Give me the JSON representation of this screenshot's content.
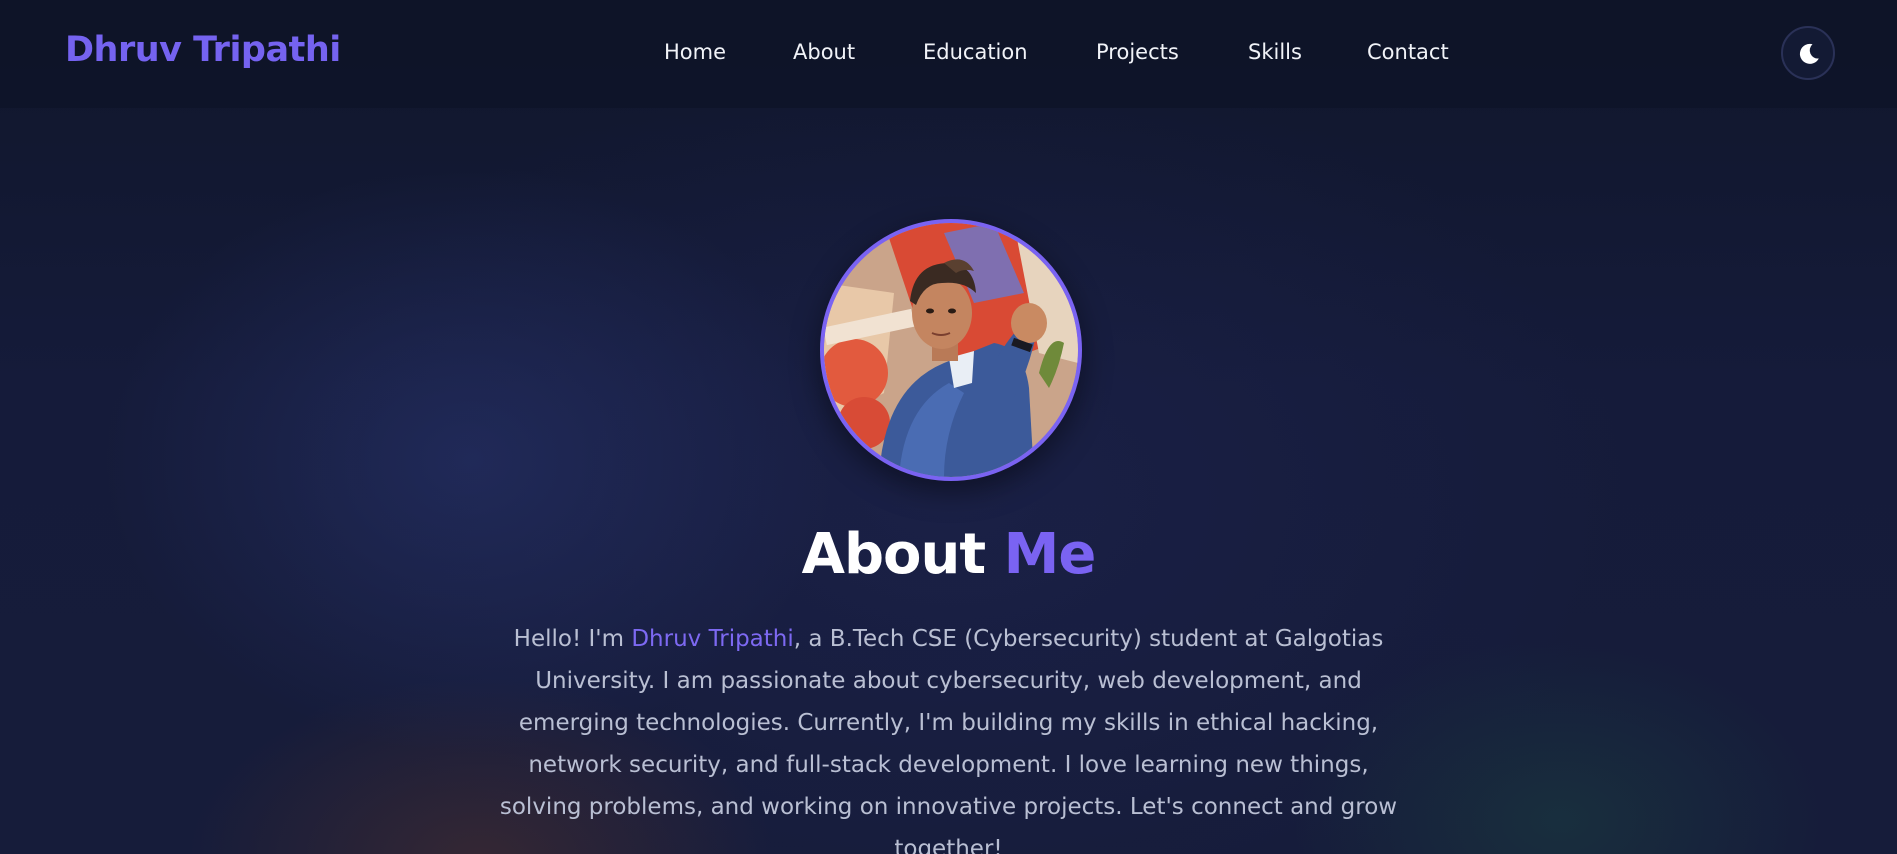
{
  "brand": "Dhruv Tripathi",
  "nav": {
    "items": [
      {
        "label": "Home"
      },
      {
        "label": "About"
      },
      {
        "label": "Education"
      },
      {
        "label": "Projects"
      },
      {
        "label": "Skills"
      },
      {
        "label": "Contact"
      }
    ]
  },
  "theme_toggle": {
    "icon": "moon-icon"
  },
  "profile": {
    "avatar": "profile-photo"
  },
  "about": {
    "title_main": "About",
    "title_accent": "Me",
    "intro_prefix": "Hello! I'm ",
    "intro_name": "Dhruv Tripathi",
    "intro_rest": ", a B.Tech CSE (Cybersecurity) student at Galgotias University. I am passionate about cybersecurity, web development, and emerging technologies. Currently, I'm building my skills in ethical hacking, network security, and full-stack development. I love learning new things, solving problems, and working on innovative projects. Let's connect and grow together!"
  },
  "colors": {
    "accent": "#7a63f2",
    "background": "#141a33",
    "text": "#b9bfd3"
  }
}
